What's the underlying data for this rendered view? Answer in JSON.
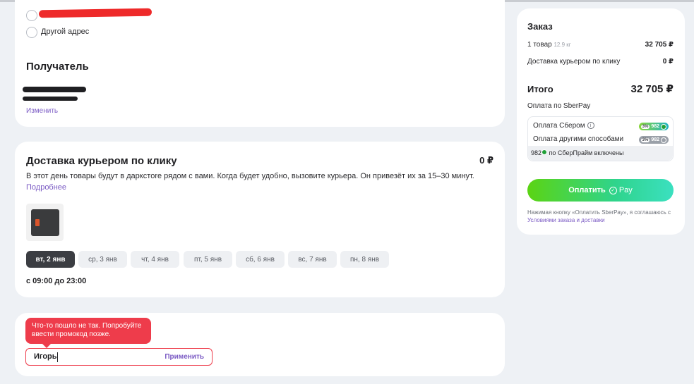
{
  "address": {
    "other_address_label": "Другой адрес",
    "recipient_title": "Получатель",
    "change_link": "Изменить"
  },
  "delivery": {
    "title": "Доставка курьером по клику",
    "price": "0 ₽",
    "description": "В этот день товары будут в даркстore рядом с вами. Когда будет удобно, вызовите курьера. Он привезёт их за 15–30 минут.",
    "more_link": "Подробнее",
    "dates": [
      {
        "label": "вт, 2 янв",
        "active": true
      },
      {
        "label": "ср, 3 янв",
        "active": false
      },
      {
        "label": "чт, 4 янв",
        "active": false
      },
      {
        "label": "пт, 5 янв",
        "active": false
      },
      {
        "label": "сб, 6 янв",
        "active": false
      },
      {
        "label": "вс, 7 янв",
        "active": false
      },
      {
        "label": "пн, 8 янв",
        "active": false
      }
    ],
    "time_range": "с 09:00 до 23:00"
  },
  "promo": {
    "error_text": "Что-то пошло не так. Попробуйте ввести промокод позже.",
    "input_value": "Игорь",
    "apply_label": "Применить"
  },
  "order": {
    "title": "Заказ",
    "items_label": "1 товар",
    "items_weight": "12.9 кг",
    "items_price": "32 705 ₽",
    "delivery_label": "Доставка курьером по клику",
    "delivery_price": "0 ₽",
    "total_label": "Итого",
    "total_price": "32 705 ₽",
    "payment_method": "Оплата по SberPay",
    "pay_sber_label": "Оплата Сбером",
    "pay_sber_percent": "3%",
    "pay_sber_bonus": "982",
    "pay_other_label": "Оплата другими способами",
    "pay_other_percent": "3%",
    "pay_other_bonus": "982",
    "sberprime_bonus": "982",
    "sberprime_text": "по СберПрайм включены",
    "pay_button_label": "Оплатить",
    "pay_button_brand": "Pay",
    "terms_text": "Нажимая кнопку «Оплатить SberPay», я соглашаюсь с",
    "terms_link": "Условиями заказа и доставки"
  },
  "colors": {
    "accent_link": "#7b5bc4",
    "error": "#ee3c4b",
    "active_chip": "#3b3d42",
    "sber_green": "#21a038"
  }
}
